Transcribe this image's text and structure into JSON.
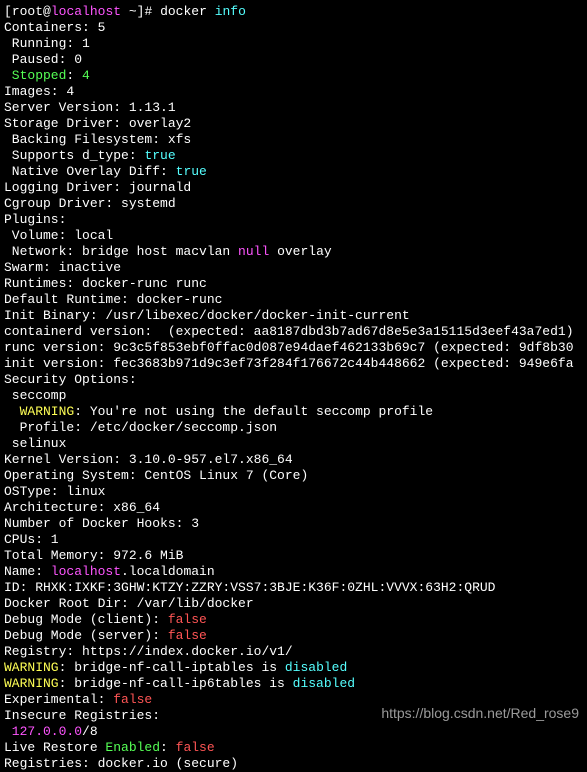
{
  "prompt": {
    "user": "root",
    "at": "@",
    "host": "localhost",
    "path": " ~]# ",
    "cmd": "docker ",
    "sub": "info"
  },
  "out": {
    "containers": "Containers: 5",
    "running": " Running: 1",
    "paused": " Paused: 0",
    "stopped_label": " Stopped",
    "stopped_sep": ": ",
    "stopped_val": "4",
    "images": "Images: 4",
    "server_version": "Server Version: 1.13.1",
    "storage_driver": "Storage Driver: overlay2",
    "backing_fs": " Backing Filesystem: xfs",
    "supports_dtype_label": " Supports d_type: ",
    "supports_dtype_val": "true",
    "native_overlay_label": " Native Overlay Diff: ",
    "native_overlay_val": "true",
    "logging_driver": "Logging Driver: journald",
    "cgroup_driver": "Cgroup Driver: systemd",
    "plugins": "Plugins:",
    "volume": " Volume: local",
    "network_pre": " Network: bridge host macvlan ",
    "network_null": "null",
    "network_post": " overlay",
    "swarm": "Swarm: inactive",
    "runtimes": "Runtimes: docker-runc runc",
    "default_runtime": "Default Runtime: docker-runc",
    "init_binary": "Init Binary: /usr/libexec/docker/docker-init-current",
    "containerd_version": "containerd version:  (expected: aa8187dbd3b7ad67d8e5e3a15115d3eef43a7ed1)",
    "runc_version": "runc version: 9c3c5f853ebf0ffac0d087e94daef462133b69c7 (expected: 9df8b30",
    "init_version": "init version: fec3683b971d9c3ef73f284f176672c44b448662 (expected: 949e6fa",
    "security_options": "Security Options:",
    "seccomp": " seccomp",
    "warning_label": "  WARNING",
    "warning_text": ": You're not using the default seccomp profile",
    "profile": "  Profile: /etc/docker/seccomp.json",
    "selinux": " selinux",
    "kernel_version": "Kernel Version: 3.10.0-957.el7.x86_64",
    "operating_system": "Operating System: CentOS Linux 7 (Core)",
    "ostype": "OSType: linux",
    "architecture": "Architecture: x86_64",
    "docker_hooks": "Number of Docker Hooks: 3",
    "cpus": "CPUs: 1",
    "total_memory": "Total Memory: 972.6 MiB",
    "name_pre": "Name: ",
    "name_host": "localhost",
    "name_post": ".localdomain",
    "id": "ID: RHXK:IXKF:3GHW:KTZY:ZZRY:VSS7:3BJE:K36F:0ZHL:VVVX:63H2:QRUD",
    "docker_root": "Docker Root Dir: /var/lib/docker",
    "debug_client_label": "Debug Mode (client): ",
    "debug_client_val": "false",
    "debug_server_label": "Debug Mode (server): ",
    "debug_server_val": "false",
    "registry": "Registry: https://index.docker.io/v1/",
    "warn1_label": "WARNING",
    "warn1_mid": ": bridge-nf-call-iptables is ",
    "warn1_val": "disabled",
    "warn2_label": "WARNING",
    "warn2_mid": ": bridge-nf-call-ip6tables is ",
    "warn2_val": "disabled",
    "experimental_label": "Experimental: ",
    "experimental_val": "false",
    "insecure_registries": "Insecure Registries:",
    "insecure_ip": " 127.0.0.0",
    "insecure_suffix": "/8",
    "live_restore_pre": "Live Restore ",
    "live_restore_mid": "Enabled",
    "live_restore_sep": ": ",
    "live_restore_val": "false",
    "registries": "Registries: docker.io (secure)"
  },
  "watermark": "https://blog.csdn.net/Red_rose9"
}
